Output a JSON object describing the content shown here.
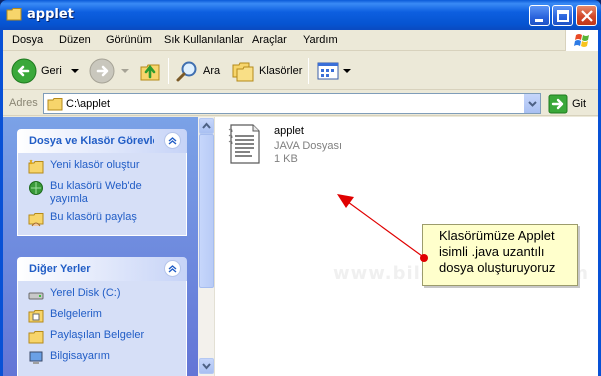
{
  "window": {
    "title": "applet"
  },
  "menu": [
    "Dosya",
    "Düzen",
    "Görünüm",
    "Sık Kullanılanlar",
    "Araçlar",
    "Yardım"
  ],
  "toolbar": {
    "back_label": "Geri",
    "search_label": "Ara",
    "folders_label": "Klasörler"
  },
  "address": {
    "label": "Adres",
    "path": "C:\\applet",
    "go_label": "Git"
  },
  "taskpane": {
    "tasks_panel": {
      "title": "Dosya ve Klasör Görevleri",
      "items": [
        {
          "label": "Yeni klasör oluştur",
          "icon": "new-folder-icon"
        },
        {
          "label": "Bu klasörü Web'de yayımla",
          "icon": "publish-web-icon"
        },
        {
          "label": "Bu klasörü paylaş",
          "icon": "share-folder-icon"
        }
      ]
    },
    "places_panel": {
      "title": "Diğer Yerler",
      "items": [
        {
          "label": "Yerel Disk (C:)",
          "icon": "drive-icon"
        },
        {
          "label": "Belgelerim",
          "icon": "my-documents-icon"
        },
        {
          "label": "Paylaşılan Belgeler",
          "icon": "shared-documents-icon"
        },
        {
          "label": "Bilgisayarım",
          "icon": "my-computer-icon"
        }
      ]
    }
  },
  "file": {
    "name": "applet",
    "type": "JAVA Dosyası",
    "size": "1 KB"
  },
  "callout": {
    "text": "Klasörümüze Applet isimli .java uzantılı dosya oluşturuyoruz"
  },
  "watermark": "www.bilgisayarder.com",
  "colors": {
    "titlebar": "#0654d1",
    "taskpane_link": "#215dc6",
    "callout_bg": "#ffffcc",
    "arrow": "#e00000"
  }
}
